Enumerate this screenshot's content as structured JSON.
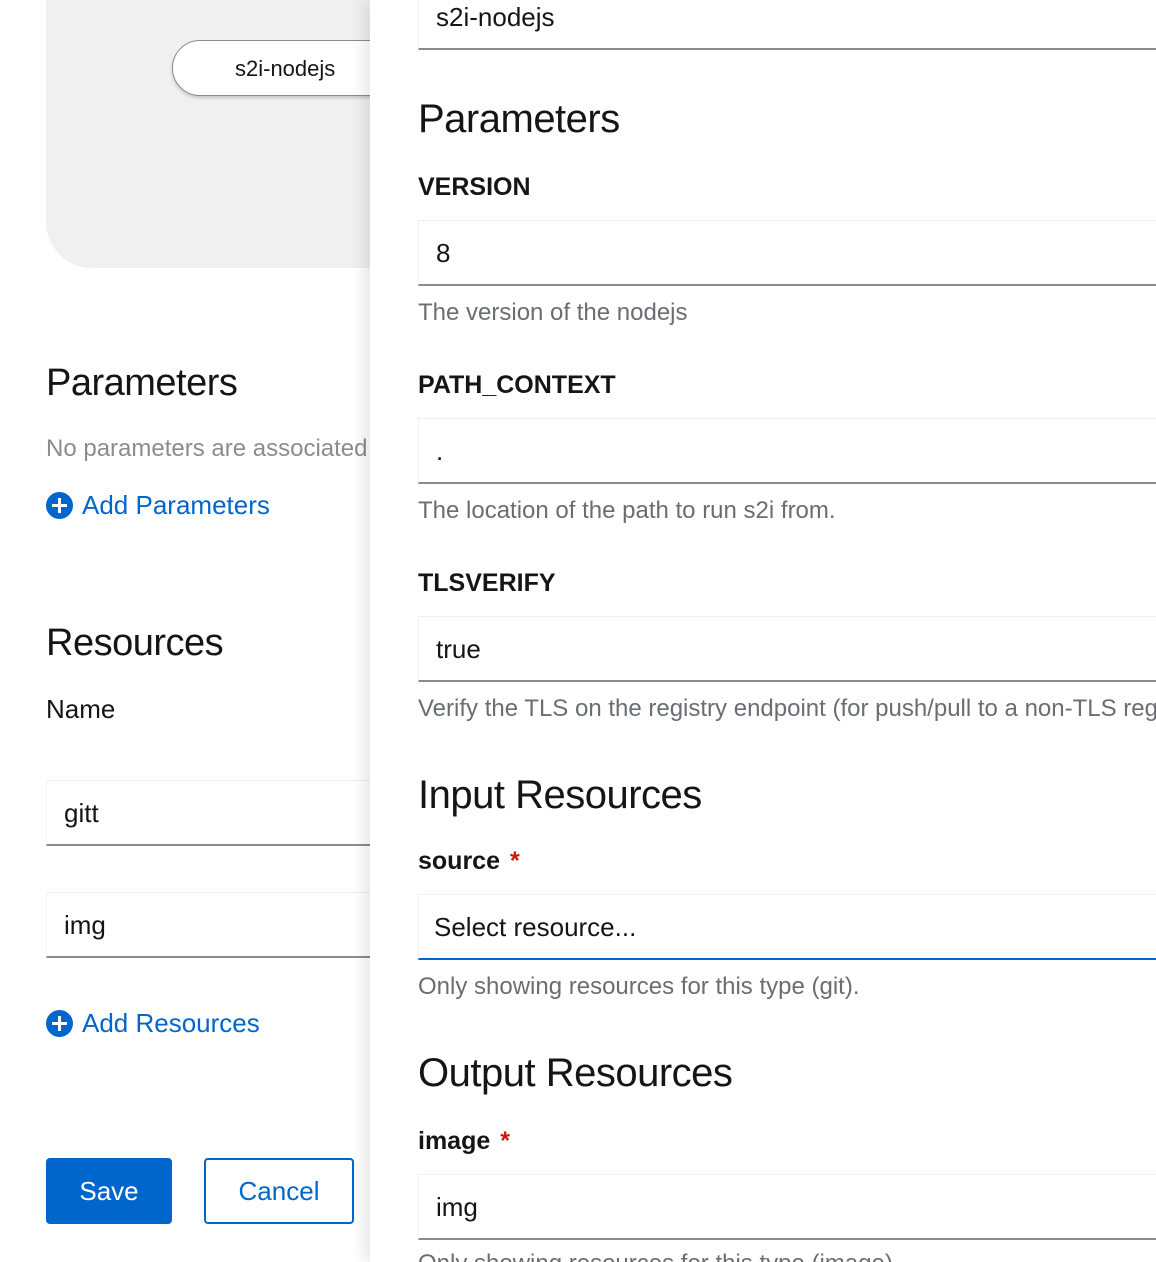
{
  "left": {
    "node_label": "s2i-nodejs",
    "parameters_title": "Parameters",
    "parameters_empty": "No parameters are associated with this pipeline.",
    "add_parameters": "Add Parameters",
    "resources_title": "Resources",
    "name_label": "Name",
    "resources": [
      {
        "name": "gitt"
      },
      {
        "name": "img"
      }
    ],
    "add_resources": "Add Resources",
    "save_label": "Save",
    "cancel_label": "Cancel"
  },
  "sidebar": {
    "task_name_value": "s2i-nodejs",
    "parameters_title": "Parameters",
    "params": [
      {
        "label": "VERSION",
        "value": "8",
        "help": "The version of the nodejs"
      },
      {
        "label": "PATH_CONTEXT",
        "value": ".",
        "help": "The location of the path to run s2i from."
      },
      {
        "label": "TLSVERIFY",
        "value": "true",
        "help": "Verify the TLS on the registry endpoint (for push/pull to a non-TLS registry)"
      }
    ],
    "input_resources_title": "Input Resources",
    "input_resource": {
      "label": "source",
      "required_mark": "*",
      "placeholder": "Select resource...",
      "help": "Only showing resources for this type (git)."
    },
    "output_resources_title": "Output Resources",
    "output_resource": {
      "label": "image",
      "required_mark": "*",
      "value": "img",
      "help": "Only showing resources for this type (image)."
    }
  },
  "colors": {
    "primary": "#0066cc",
    "required": "#c9190b",
    "muted_text": "#6a6e73",
    "canvas_bg": "#f0f0f0"
  },
  "icons": [
    "plus-circle-icon"
  ]
}
